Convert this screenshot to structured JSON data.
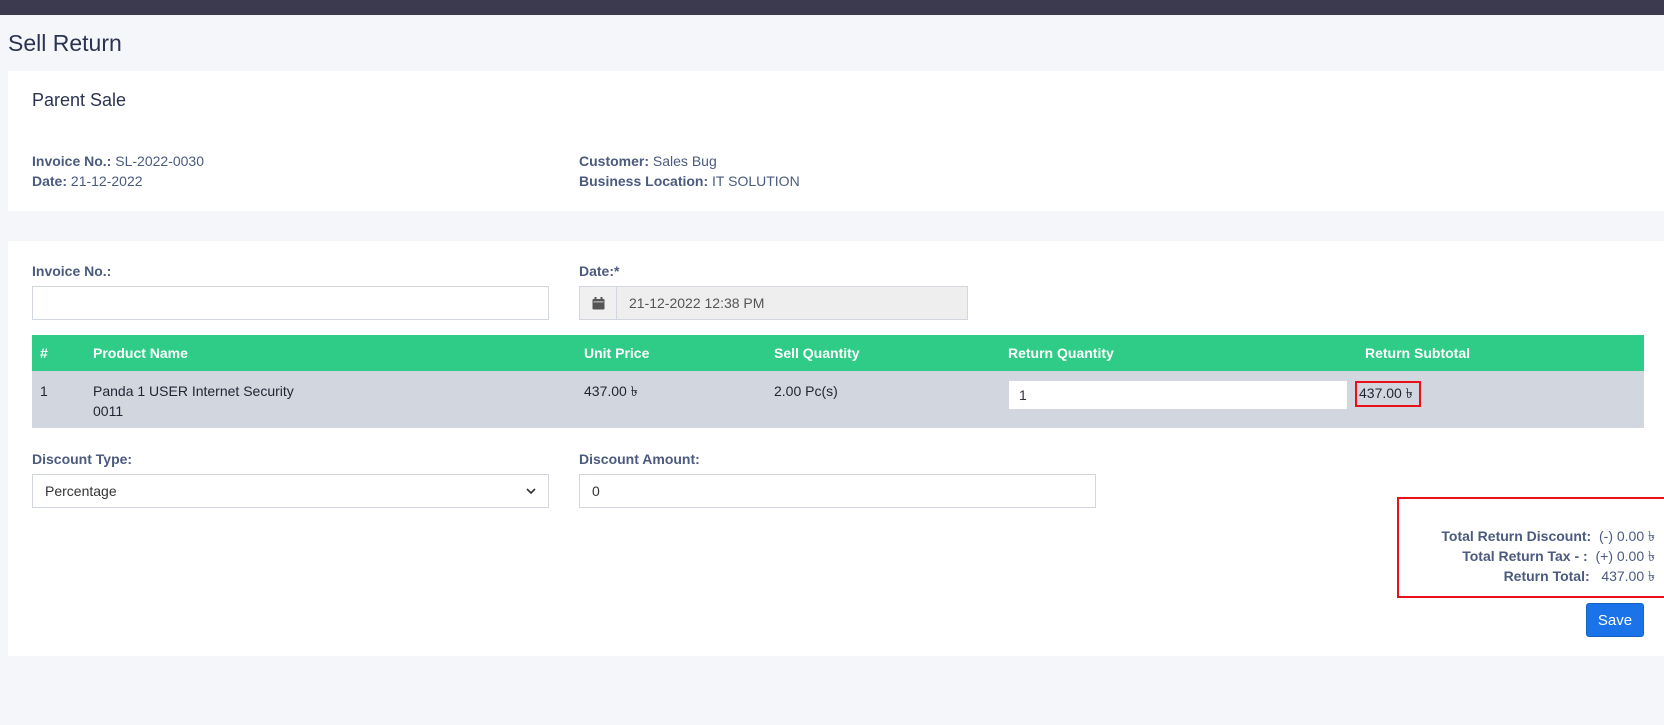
{
  "page": {
    "title": "Sell Return"
  },
  "parent_sale": {
    "title": "Parent Sale",
    "invoice_label": "Invoice No.:",
    "invoice_value": "SL-2022-0030",
    "date_label": "Date:",
    "date_value": "21-12-2022",
    "customer_label": "Customer:",
    "customer_value": "Sales Bug",
    "location_label": "Business Location:",
    "location_value": "IT SOLUTION"
  },
  "form": {
    "invoice_label": "Invoice No.:",
    "invoice_value": "",
    "date_label": "Date:*",
    "date_value": "21-12-2022 12:38 PM",
    "discount_type_label": "Discount Type:",
    "discount_type_value": "Percentage",
    "discount_amount_label": "Discount Amount:",
    "discount_amount_value": "0",
    "save_label": "Save"
  },
  "table": {
    "headers": [
      "#",
      "Product Name",
      "Unit Price",
      "Sell Quantity",
      "Return Quantity",
      "Return Subtotal"
    ],
    "rows": [
      {
        "index": "1",
        "product_name": "Panda 1 USER Internet Security",
        "product_sku": "0011",
        "unit_price": "437.00 ৳",
        "sell_quantity": "2.00 Pc(s)",
        "return_quantity": "1",
        "return_subtotal": "437.00 ৳"
      }
    ]
  },
  "totals": {
    "discount_label": "Total Return Discount:",
    "discount_value": "(-) 0.00 ৳",
    "tax_label": "Total Return Tax - :",
    "tax_value": "(+) 0.00 ৳",
    "total_label": "Return Total:",
    "total_value": "437.00 ৳"
  },
  "colors": {
    "table_header": "#2ecc87",
    "primary_button": "#1a73e8",
    "highlight_border": "#e8101a",
    "topbar": "#3b3a4e"
  },
  "icons": {
    "date_addon": "calendar-icon",
    "select_arrow": "chevron-down-icon"
  }
}
